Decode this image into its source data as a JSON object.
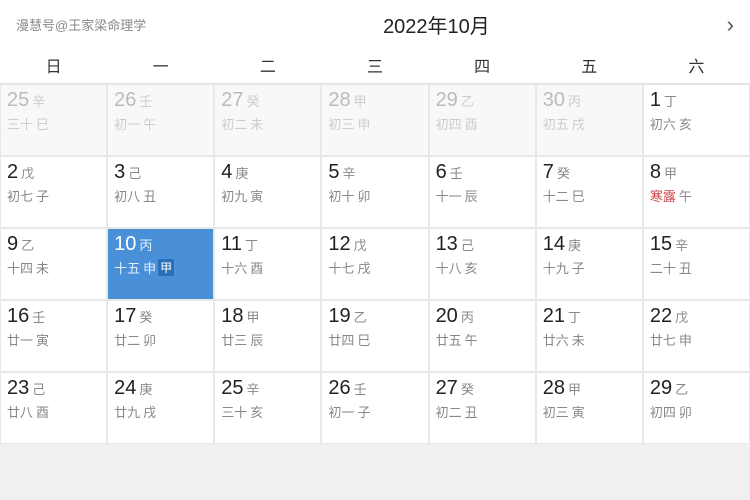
{
  "header": {
    "logo": "漫慧号@王家梁命理学",
    "title": "2022年10月",
    "arrow": "›"
  },
  "weekdays": [
    "日",
    "一",
    "二",
    "三",
    "四",
    "五",
    "六"
  ],
  "weeks": [
    [
      {
        "num": "25",
        "hs": "辛",
        "lunar": "三十",
        "eb": "巳",
        "other": true
      },
      {
        "num": "26",
        "hs": "壬",
        "lunar": "初一",
        "eb": "午",
        "other": true
      },
      {
        "num": "27",
        "hs": "癸",
        "lunar": "初二",
        "eb": "未",
        "other": true
      },
      {
        "num": "28",
        "hs": "甲",
        "lunar": "初三",
        "eb": "申",
        "other": true
      },
      {
        "num": "29",
        "hs": "乙",
        "lunar": "初四",
        "eb": "酉",
        "other": true
      },
      {
        "num": "30",
        "hs": "丙",
        "lunar": "初五",
        "eb": "戌",
        "other": true
      },
      {
        "num": "1",
        "hs": "丁",
        "lunar": "初六",
        "eb": "亥",
        "solar_term": ""
      }
    ],
    [
      {
        "num": "2",
        "hs": "戊",
        "lunar": "初七",
        "eb": "子"
      },
      {
        "num": "3",
        "hs": "己",
        "lunar": "初八",
        "eb": "丑"
      },
      {
        "num": "4",
        "hs": "庚",
        "lunar": "初九",
        "eb": "寅"
      },
      {
        "num": "5",
        "hs": "辛",
        "lunar": "初十",
        "eb": "卯"
      },
      {
        "num": "6",
        "hs": "壬",
        "lunar": "十一",
        "eb": "辰"
      },
      {
        "num": "7",
        "hs": "癸",
        "lunar": "十二",
        "eb": "巳"
      },
      {
        "num": "8",
        "hs": "甲",
        "lunar": "寒露",
        "eb": "午",
        "solar_term": "寒露"
      }
    ],
    [
      {
        "num": "9",
        "hs": "乙",
        "lunar": "十四",
        "eb": "未"
      },
      {
        "num": "10",
        "hs": "丙",
        "lunar": "十五",
        "eb": "申",
        "today": true
      },
      {
        "num": "11",
        "hs": "丁",
        "lunar": "十六",
        "eb": "酉"
      },
      {
        "num": "12",
        "hs": "戊",
        "lunar": "十七",
        "eb": "戌"
      },
      {
        "num": "13",
        "hs": "己",
        "lunar": "十八",
        "eb": "亥"
      },
      {
        "num": "14",
        "hs": "庚",
        "lunar": "十九",
        "eb": "子"
      },
      {
        "num": "15",
        "hs": "辛",
        "lunar": "二十",
        "eb": "丑"
      }
    ],
    [
      {
        "num": "16",
        "hs": "壬",
        "lunar": "廿一",
        "eb": "寅"
      },
      {
        "num": "17",
        "hs": "癸",
        "lunar": "廿二",
        "eb": "卯"
      },
      {
        "num": "18",
        "hs": "甲",
        "lunar": "廿三",
        "eb": "辰"
      },
      {
        "num": "19",
        "hs": "乙",
        "lunar": "廿四",
        "eb": "巳"
      },
      {
        "num": "20",
        "hs": "丙",
        "lunar": "廿五",
        "eb": "午"
      },
      {
        "num": "21",
        "hs": "丁",
        "lunar": "廿六",
        "eb": "未"
      },
      {
        "num": "22",
        "hs": "戊",
        "lunar": "廿七",
        "eb": "申"
      }
    ],
    [
      {
        "num": "23",
        "hs": "己",
        "lunar": "廿八",
        "eb": "酉"
      },
      {
        "num": "24",
        "hs": "庚",
        "lunar": "廿九",
        "eb": "戌"
      },
      {
        "num": "25",
        "hs": "辛",
        "lunar": "三十",
        "eb": "亥"
      },
      {
        "num": "26",
        "hs": "壬",
        "lunar": "初一",
        "eb": "子"
      },
      {
        "num": "27",
        "hs": "癸",
        "lunar": "初二",
        "eb": "丑"
      },
      {
        "num": "28",
        "hs": "甲",
        "lunar": "初三",
        "eb": "寅"
      },
      {
        "num": "29",
        "hs": "乙",
        "lunar": "初四",
        "eb": "卯"
      }
    ]
  ]
}
